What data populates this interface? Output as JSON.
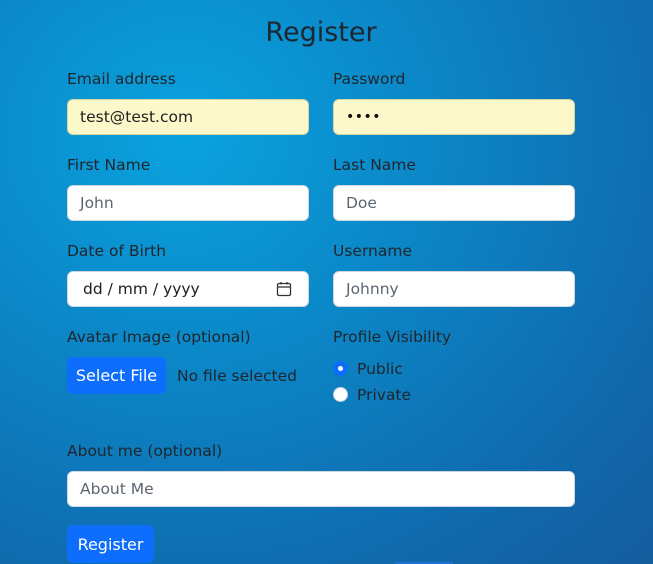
{
  "form": {
    "title": "Register",
    "email": {
      "label": "Email address",
      "value": "test@test.com"
    },
    "password": {
      "label": "Password",
      "masked_value": "••••"
    },
    "first_name": {
      "label": "First Name",
      "placeholder": "John"
    },
    "last_name": {
      "label": "Last Name",
      "placeholder": "Doe"
    },
    "dob": {
      "label": "Date of Birth",
      "placeholder": "dd / mm / yyyy",
      "icon": "calendar-icon"
    },
    "username": {
      "label": "Username",
      "placeholder": "Johnny"
    },
    "avatar": {
      "label": "Avatar Image (optional)",
      "button_label": "Select File",
      "status": "No file selected"
    },
    "visibility": {
      "label": "Profile Visibility",
      "options": [
        {
          "label": "Public",
          "selected": true
        },
        {
          "label": "Private",
          "selected": false
        }
      ]
    },
    "about": {
      "label": "About me (optional)",
      "placeholder": "About Me"
    },
    "submit_label": "Register"
  },
  "colors": {
    "accent": "#0d6efd",
    "autofill": "#fdf8c9"
  }
}
